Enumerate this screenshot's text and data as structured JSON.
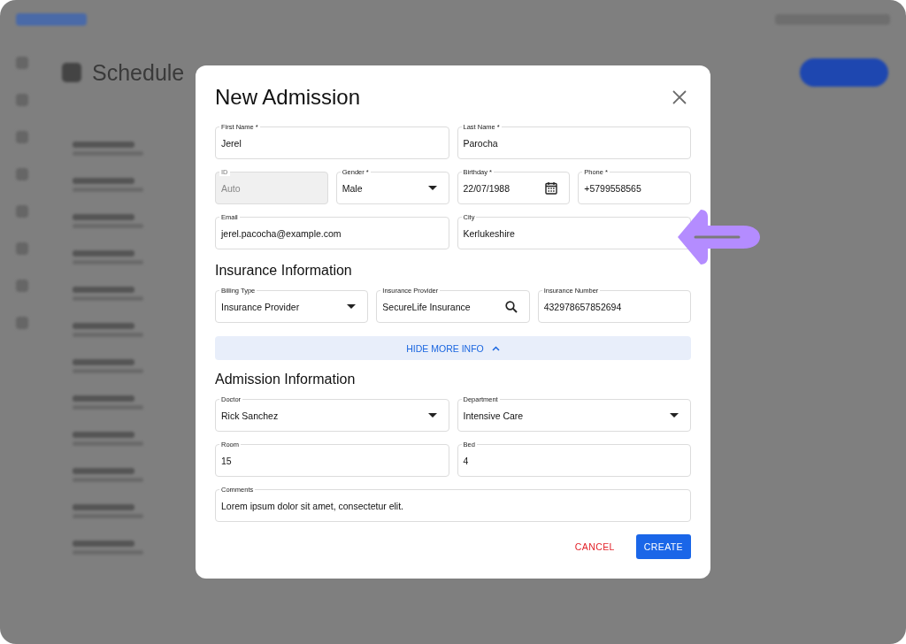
{
  "background": {
    "page_title": "Schedule"
  },
  "dialog": {
    "title": "New Admission",
    "personal": {
      "rows": [
        {
          "fields": [
            {
              "label": "First Name *",
              "value": "Jerel",
              "kind": "text",
              "disabled": false
            },
            {
              "label": "Last Name *",
              "value": "Parocha",
              "kind": "text",
              "disabled": false
            }
          ]
        },
        {
          "fields": [
            {
              "label": "ID",
              "placeholder": "Auto",
              "kind": "text",
              "disabled": true
            },
            {
              "label": "Gender *",
              "value": "Male",
              "kind": "select",
              "disabled": false
            },
            {
              "label": "Birthday *",
              "value": "22/07/1988",
              "kind": "date",
              "disabled": false
            },
            {
              "label": "Phone *",
              "value": "+5799558565",
              "kind": "text",
              "disabled": false
            }
          ]
        },
        {
          "fields": [
            {
              "label": "Email",
              "value": "jerel.pacocha@example.com",
              "kind": "text",
              "disabled": false
            },
            {
              "label": "City",
              "value": "Kerlukeshire",
              "kind": "text",
              "disabled": false
            }
          ]
        }
      ]
    },
    "insurance": {
      "heading": "Insurance Information",
      "rows": [
        {
          "fields": [
            {
              "label": "Billing Type",
              "value": "Insurance Provider",
              "kind": "select",
              "disabled": false
            },
            {
              "label": "Insurance Provider",
              "value": "SecureLife Insurance",
              "kind": "search",
              "disabled": false
            },
            {
              "label": "Insurance Number",
              "value": "432978657852694",
              "kind": "text",
              "disabled": false
            }
          ]
        }
      ]
    },
    "more_info_toggle": {
      "label": "HIDE MORE INFO",
      "expanded": true
    },
    "admission": {
      "heading": "Admission Information",
      "rows": [
        {
          "fields": [
            {
              "label": "Doctor",
              "value": "Rick Sanchez",
              "kind": "select",
              "disabled": false
            },
            {
              "label": "Department",
              "value": "Intensive Care",
              "kind": "select",
              "disabled": false
            }
          ]
        },
        {
          "fields": [
            {
              "label": "Room",
              "value": "15",
              "kind": "text",
              "disabled": false
            },
            {
              "label": "Bed",
              "value": "4",
              "kind": "text",
              "disabled": false
            }
          ]
        },
        {
          "fields": [
            {
              "label": "Comments",
              "value": "Lorem ipsum dolor sit amet, consectetur elit.",
              "kind": "text",
              "disabled": false
            }
          ]
        }
      ]
    },
    "actions": [
      {
        "label": "CANCEL",
        "kind": "text"
      },
      {
        "label": "CREATE",
        "kind": "primary"
      }
    ]
  }
}
